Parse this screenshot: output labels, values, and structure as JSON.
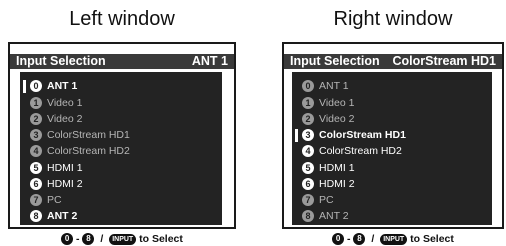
{
  "left": {
    "caption": "Left window",
    "header_title": "Input Selection",
    "header_current": "ANT 1",
    "items": [
      {
        "num": "0",
        "label": "ANT 1"
      },
      {
        "num": "1",
        "label": "Video 1"
      },
      {
        "num": "2",
        "label": "Video 2"
      },
      {
        "num": "3",
        "label": "ColorStream HD1"
      },
      {
        "num": "4",
        "label": "ColorStream HD2"
      },
      {
        "num": "5",
        "label": "HDMI 1"
      },
      {
        "num": "6",
        "label": "HDMI 2"
      },
      {
        "num": "7",
        "label": "PC"
      },
      {
        "num": "8",
        "label": "ANT 2"
      }
    ],
    "footer": {
      "from": "0",
      "dash": "-",
      "to": "8",
      "slash": "/",
      "input_label": "INPUT",
      "tail": "to Select"
    }
  },
  "right": {
    "caption": "Right window",
    "header_title": "Input Selection",
    "header_current": "ColorStream HD1",
    "items": [
      {
        "num": "0",
        "label": "ANT 1"
      },
      {
        "num": "1",
        "label": "Video 1"
      },
      {
        "num": "2",
        "label": "Video 2"
      },
      {
        "num": "3",
        "label": "ColorStream HD1"
      },
      {
        "num": "4",
        "label": "ColorStream HD2"
      },
      {
        "num": "5",
        "label": "HDMI 1"
      },
      {
        "num": "6",
        "label": "HDMI 2"
      },
      {
        "num": "7",
        "label": "PC"
      },
      {
        "num": "8",
        "label": "ANT 2"
      }
    ],
    "footer": {
      "from": "0",
      "dash": "-",
      "to": "8",
      "slash": "/",
      "input_label": "INPUT",
      "tail": "to Select"
    }
  }
}
